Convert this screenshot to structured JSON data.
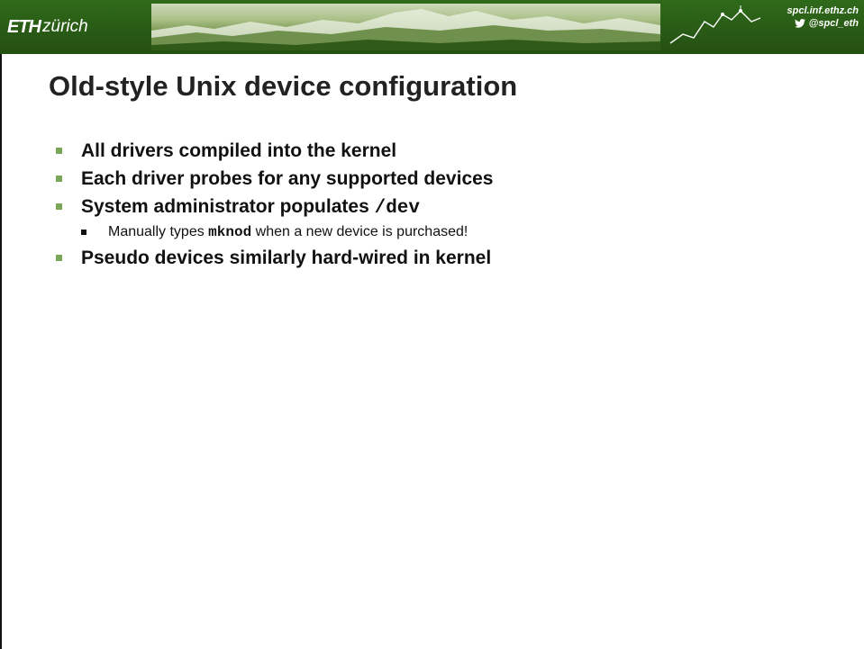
{
  "header": {
    "logo_eth": "ETH",
    "logo_zurich": "zürich",
    "site_url": "spcl.inf.ethz.ch",
    "twitter_handle": "@spcl_eth",
    "colors": {
      "header_bg": "#2f6a1a",
      "bullet_accent": "#7aa657"
    }
  },
  "slide": {
    "title": "Old-style Unix device configuration",
    "bullets": [
      {
        "text": "All drivers compiled into the kernel"
      },
      {
        "text": "Each driver probes for any supported devices"
      },
      {
        "text_pre": "System administrator populates ",
        "code": "/dev"
      },
      {
        "sub": true,
        "text_pre": "Manually types ",
        "code": "mknod",
        "text_post": " when a new device is purchased!"
      },
      {
        "text": "Pseudo devices similarly hard-wired in kernel"
      }
    ]
  },
  "icons": {
    "twitter": "twitter-bird-icon",
    "spcl": "spcl-mountain-logo"
  }
}
